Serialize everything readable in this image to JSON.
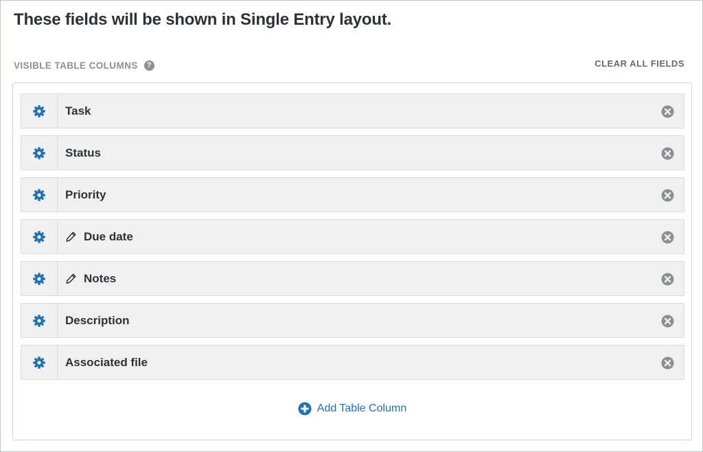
{
  "heading": "These fields will be shown in Single Entry layout.",
  "section": {
    "label": "VISIBLE TABLE COLUMNS",
    "help_icon": "question-circle-icon",
    "clear_all_label": "CLEAR ALL FIELDS"
  },
  "fields": [
    {
      "label": "Task",
      "editable": false
    },
    {
      "label": "Status",
      "editable": false
    },
    {
      "label": "Priority",
      "editable": false
    },
    {
      "label": "Due date",
      "editable": true
    },
    {
      "label": "Notes",
      "editable": true
    },
    {
      "label": "Description",
      "editable": false
    },
    {
      "label": "Associated file",
      "editable": false
    }
  ],
  "add_column_label": "Add Table Column",
  "icons": {
    "settings": "gear-icon",
    "edit": "pencil-icon",
    "remove": "close-circle-icon",
    "add": "plus-circle-icon"
  },
  "colors": {
    "accent": "#2271b1",
    "gear": "#2271b1",
    "remove": "#8c8f94",
    "row_bg": "#f0f0f1",
    "panel_border": "#c5d9ea"
  }
}
